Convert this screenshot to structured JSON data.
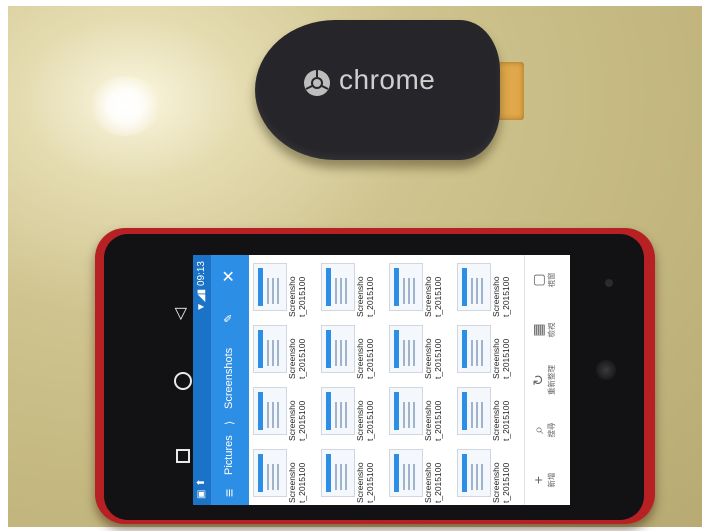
{
  "dongle": {
    "brand": "chrome"
  },
  "status_bar": {
    "left": "▣ ⬆",
    "right": "▼◢▮ 09:13",
    "center": "▣ 未選"
  },
  "toolbar": {
    "menu": "≡",
    "crumb_1": "Pictures",
    "separator": "⟩",
    "crumb_2": "Screenshots",
    "edit": "✎",
    "close": "✕"
  },
  "files": [
    {
      "name": "Screensho t_2015100"
    },
    {
      "name": "Screensho t_2015100"
    },
    {
      "name": "Screensho t_2015100"
    },
    {
      "name": "Screensho t_2015100"
    },
    {
      "name": "Screensho t_2015100"
    },
    {
      "name": "Screensho t_2015100"
    },
    {
      "name": "Screensho t_2015100"
    },
    {
      "name": "Screensho t_2015100"
    },
    {
      "name": "Screensho t_2015100"
    },
    {
      "name": "Screensho t_2015100"
    },
    {
      "name": "Screensho t_2015100"
    },
    {
      "name": "Screensho t_2015100"
    },
    {
      "name": "Screensho t_2015100"
    },
    {
      "name": "Screensho t_2015100"
    },
    {
      "name": "Screensho t_2015100"
    },
    {
      "name": "Screensho t_2015100"
    }
  ],
  "bottom_bar": [
    {
      "icon": "+",
      "label": "新增"
    },
    {
      "icon": "⌕",
      "label": "搜尋"
    },
    {
      "icon": "↻",
      "label": "重新整理"
    },
    {
      "icon": "▦",
      "label": "檢視"
    },
    {
      "icon": "▢",
      "label": "視窗"
    }
  ],
  "colors": {
    "case": "#b82124",
    "appbar": "#2d8ee6",
    "statusbar": "#1a73c7"
  }
}
